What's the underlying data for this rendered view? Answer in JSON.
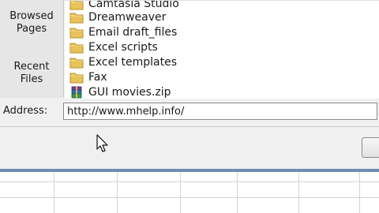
{
  "places_bar": {
    "browsed_pages": [
      "Browsed",
      "Pages"
    ],
    "recent_files": [
      "Recent",
      "Files"
    ]
  },
  "files": [
    {
      "name": "Camtasia Studio",
      "icon": "folder-icon"
    },
    {
      "name": "Dreamweaver",
      "icon": "folder-icon"
    },
    {
      "name": "Email draft_files",
      "icon": "folder-icon"
    },
    {
      "name": "Excel scripts",
      "icon": "folder-icon"
    },
    {
      "name": "Excel templates",
      "icon": "folder-icon"
    },
    {
      "name": "Fax",
      "icon": "folder-icon"
    },
    {
      "name": "GUI movies.zip",
      "icon": "zip-archive-icon"
    }
  ],
  "address": {
    "label": "Address:",
    "value": "http://www.mhelp.info/"
  },
  "colors": {
    "folder": "#e8c35a",
    "dialog_bg": "#f0f0f0",
    "dialog_edge": "#6e8fb4"
  }
}
